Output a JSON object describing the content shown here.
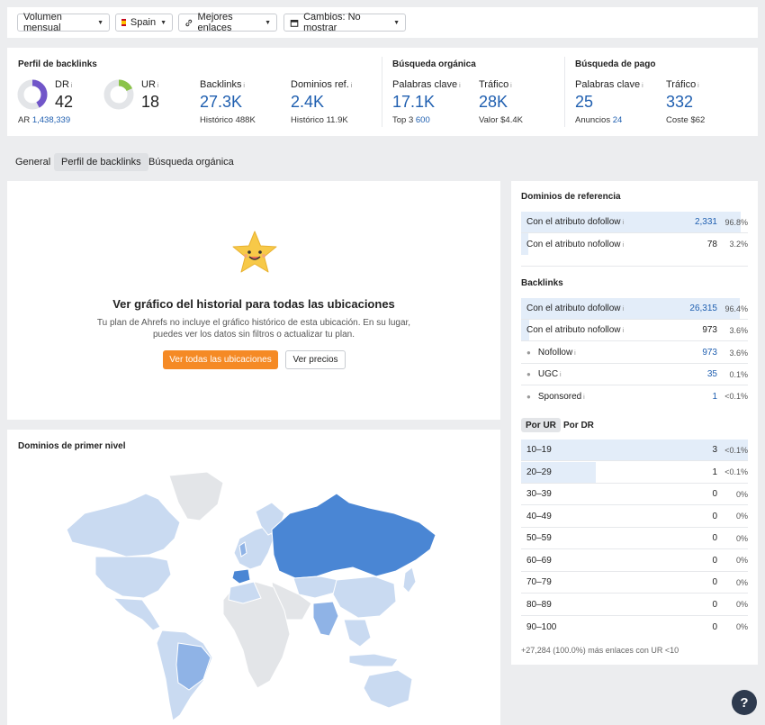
{
  "toolbar": {
    "volume": "Volumen mensual",
    "country": "Spain",
    "links": "Mejores enlaces",
    "changes": "Cambios: No mostrar"
  },
  "overview": {
    "backlink_profile_title": "Perfil de backlinks",
    "dr_label": "DR",
    "dr_value": "42",
    "ar_label": "AR",
    "ar_value": "1,438,339",
    "ur_label": "UR",
    "ur_value": "18",
    "backlinks_label": "Backlinks",
    "backlinks_value": "27.3K",
    "backlinks_hist_label": "Histórico",
    "backlinks_hist_value": "488K",
    "refdomains_label": "Dominios ref.",
    "refdomains_value": "2.4K",
    "refdomains_hist_label": "Histórico",
    "refdomains_hist_value": "11.9K",
    "organic_title": "Búsqueda orgánica",
    "org_kw_label": "Palabras clave",
    "org_kw_value": "17.1K",
    "org_top3_label": "Top 3",
    "org_top3_value": "600",
    "org_traffic_label": "Tráfico",
    "org_traffic_value": "28K",
    "org_value_label": "Valor",
    "org_value_value": "$4.4K",
    "paid_title": "Búsqueda de pago",
    "paid_kw_label": "Palabras clave",
    "paid_kw_value": "25",
    "paid_ads_label": "Anuncios",
    "paid_ads_value": "24",
    "paid_traffic_label": "Tráfico",
    "paid_traffic_value": "332",
    "paid_cost_label": "Coste",
    "paid_cost_value": "$62",
    "dr_fraction": 0.42,
    "ur_fraction": 0.18
  },
  "tabs": [
    "General",
    "Perfil de backlinks",
    "Búsqueda orgánica"
  ],
  "upsell": {
    "title": "Ver gráfico del historial para todas las ubicaciones",
    "desc1": "Tu plan de Ahrefs no incluye el gráfico histórico de esta ubicación. En su lugar,",
    "desc2": "puedes ver los datos sin filtros o actualizar tu plan.",
    "primary_button": "Ver todas las ubicaciones",
    "secondary_button": "Ver precios"
  },
  "map": {
    "title": "Dominios de primer nivel"
  },
  "ref_domains": {
    "title": "Dominios de referencia",
    "rows": [
      {
        "label": "Con el atributo dofollow",
        "value": "2,331",
        "pct": "96.8%",
        "share": 0.968
      },
      {
        "label": "Con el atributo nofollow",
        "value": "78",
        "pct": "3.2%",
        "share": 0.032
      }
    ]
  },
  "backlinks": {
    "title": "Backlinks",
    "rows": [
      {
        "label": "Con el atributo dofollow",
        "value": "26,315",
        "pct": "96.4%",
        "share": 0.964
      },
      {
        "label": "Con el atributo nofollow",
        "value": "973",
        "pct": "3.6%",
        "share": 0.036
      },
      {
        "label": "Nofollow",
        "value": "973",
        "pct": "3.6%"
      },
      {
        "label": "UGC",
        "value": "35",
        "pct": "0.1%"
      },
      {
        "label": "Sponsored",
        "value": "1",
        "pct": "<0.1%"
      }
    ]
  },
  "ur_tabs": [
    "Por UR",
    "Por DR"
  ],
  "ur_rows": [
    {
      "label": "10–19",
      "value": "3",
      "pct": "<0.1%",
      "share": 1.0
    },
    {
      "label": "20–29",
      "value": "1",
      "pct": "<0.1%",
      "share": 0.33
    },
    {
      "label": "30–39",
      "value": "0",
      "pct": "0%",
      "share": 0
    },
    {
      "label": "40–49",
      "value": "0",
      "pct": "0%",
      "share": 0
    },
    {
      "label": "50–59",
      "value": "0",
      "pct": "0%",
      "share": 0
    },
    {
      "label": "60–69",
      "value": "0",
      "pct": "0%",
      "share": 0
    },
    {
      "label": "70–79",
      "value": "0",
      "pct": "0%",
      "share": 0
    },
    {
      "label": "80–89",
      "value": "0",
      "pct": "0%",
      "share": 0
    },
    {
      "label": "90–100",
      "value": "0",
      "pct": "0%",
      "share": 0
    }
  ],
  "ur_footer": "+27,284 (100.0%) más enlaces con UR <10",
  "help": "?",
  "colors": {
    "accent_blue": "#1f5fb0",
    "dr_purple": "#7156c9",
    "ur_green": "#8bc34a",
    "cta_orange": "#f58a25",
    "map_dark": "#4a86d4",
    "map_light": "#c9daf1"
  }
}
